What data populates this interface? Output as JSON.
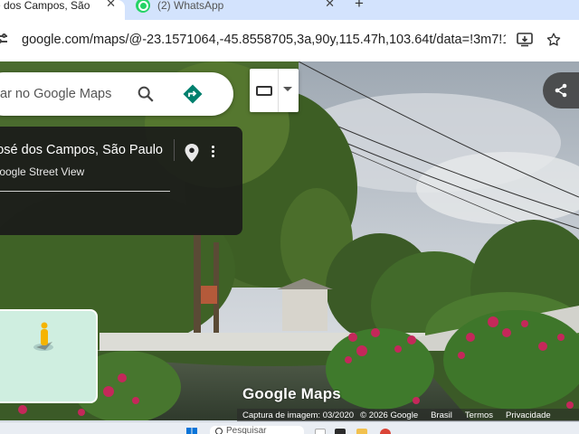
{
  "browser": {
    "tabs": [
      {
        "title": "é dos Campos, São Paulo",
        "active": true
      },
      {
        "title": "(2) WhatsApp",
        "active": false
      }
    ],
    "tab_close_glyph": "✕",
    "new_tab_glyph": "+",
    "url": "google.com/maps/@-23.1571064,-45.8558705,3a,90y,115.47h,103.64t/data=!3m7!1...",
    "icons": [
      "site-settings-icon",
      "install-app-icon",
      "bookmark-star-icon"
    ]
  },
  "maps": {
    "search_placeholder": "ar no Google Maps",
    "place_title": "José dos Campos, São Paulo",
    "place_subtitle": "Google Street View",
    "logo": "Google Maps",
    "attribution": {
      "capture_date": "Captura de imagem: 03/2020",
      "copyright": "© 2026 Google",
      "links": [
        "Brasil",
        "Termos",
        "Privacidade"
      ]
    }
  },
  "taskbar": {
    "search_label": "Pesquisar"
  },
  "colors": {
    "accent_blue": "#1a73e8",
    "directions_teal": "#00806e",
    "whatsapp_green": "#25d366",
    "tabstrip": "#d3e3fd",
    "pegman": "#f5b400"
  }
}
